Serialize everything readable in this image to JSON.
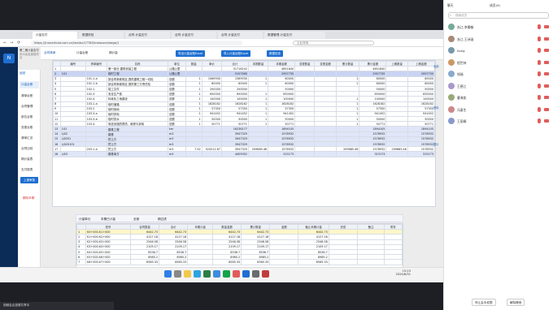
{
  "browser": {
    "tabs": [
      "计量支付",
      "数据校验",
      "合同-计量支付",
      "合同-计量支付",
      "合同-计量支付",
      "数据管理-计量支付"
    ],
    "url": "https://jl.smartcod.com.cn/tender/17785/measure/stage/1",
    "search_placeholder": "点此搜索"
  },
  "app": {
    "project": "第二期计量支付",
    "subtitle": "贵州省高速路项目",
    "back": "返回",
    "nav": [
      "计量台账",
      "清单台账",
      "合同管理",
      "部位台账",
      "变更台账",
      "清单汇总",
      "合同比较",
      "期计量表",
      "支付报表",
      "结算报表"
    ],
    "nav_button": "上报审核",
    "nav_action": "删除本期",
    "toolbar_left": [
      "合同清单",
      "计量台账",
      "期计量"
    ],
    "toolbar_buttons": [
      "导出计量台账Excel",
      "导入计量台账Excel",
      "数据检查"
    ]
  },
  "grid1": {
    "headers": [
      "",
      "编号",
      "清单编号",
      "名称",
      "单位",
      "数量",
      "单价",
      "合计",
      "本期数量",
      "本期金额",
      "变更数量",
      "变更金额",
      "累计数量",
      "累计金额",
      "上期数量",
      "上期金额"
    ],
    "rows": [
      {
        "cls": "",
        "no": "1",
        "code": "",
        "bill": "",
        "name": "第一部分 建筑安装工程",
        "unit": "公路公里",
        "qty": "",
        "price": "",
        "total": "31716142",
        "q1": "",
        "a1": "4851840",
        "q2": "",
        "a2": "",
        "q3": "",
        "a3": "4851840",
        "q4": "",
        "a4": ""
      },
      {
        "cls": "blue",
        "no": "2",
        "code": "101",
        "bill": "",
        "name": "临时工程",
        "unit": "公路公里",
        "qty": "",
        "price": "",
        "total": "5157565",
        "q1": "",
        "a1": "2957735",
        "q2": "",
        "a2": "",
        "q3": "",
        "a3": "2957735",
        "q4": "",
        "a4": "2957735"
      },
      {
        "cls": "",
        "no": "3",
        "code": "",
        "bill": "101-1-a",
        "name": "按合同条款规定,提供建筑工程一切险",
        "unit": "总额",
        "qty": "1",
        "price": "1569930",
        "total": "1569930",
        "q1": "1",
        "a1": "60000",
        "q2": "",
        "a2": "",
        "q3": "1",
        "a3": "60000",
        "q4": "",
        "a4": "60000"
      },
      {
        "cls": "",
        "no": "4",
        "code": "",
        "bill": "101-1-b",
        "name": "按合同条款规定,提供第三方责任险",
        "unit": "总额",
        "qty": "1",
        "price": "60000",
        "total": "60000",
        "q1": "1",
        "a1": "60000",
        "q2": "",
        "a2": "",
        "q3": "1",
        "a3": "60000",
        "q4": "",
        "a4": "60000"
      },
      {
        "cls": "",
        "no": "5",
        "code": "",
        "bill": "102-1",
        "name": "竣工文件",
        "unit": "总额",
        "qty": "1",
        "price": "200000",
        "total": "200000",
        "q1": "",
        "a1": "50000",
        "q2": "",
        "a2": "",
        "q3": "",
        "a3": "50000",
        "q4": "",
        "a4": "50000"
      },
      {
        "cls": "",
        "no": "6",
        "code": "",
        "bill": "102-3",
        "name": "安全生产费",
        "unit": "总额",
        "qty": "1",
        "price": "650000",
        "total": "650000",
        "q1": "1",
        "a1": "650000",
        "q2": "",
        "a2": "",
        "q3": "",
        "a3": "650000",
        "q4": "",
        "a4": "650000"
      },
      {
        "cls": "",
        "no": "7",
        "code": "",
        "bill": "102-4",
        "name": "标准化工地建设",
        "unit": "总额",
        "qty": "1",
        "price": "100000",
        "total": "100000",
        "q1": "1",
        "a1": "100000",
        "q2": "",
        "a2": "",
        "q3": "1",
        "a3": "100000",
        "q4": "",
        "a4": "100000"
      },
      {
        "cls": "",
        "no": "8",
        "code": "",
        "bill": "103-1-a",
        "name": "临时道路",
        "unit": "总额",
        "qty": "1",
        "price": "1628162",
        "total": "1628162",
        "q1": "1",
        "a1": "1628162",
        "q2": "",
        "a2": "",
        "q3": "1",
        "a3": "1628162",
        "q4": "",
        "a4": "1628162"
      },
      {
        "cls": "",
        "no": "9",
        "code": "",
        "bill": "103-2",
        "name": "临时用地",
        "unit": "总额",
        "qty": "1",
        "price": "57350",
        "total": "57350",
        "q1": "1",
        "a1": "57350",
        "q2": "",
        "a2": "",
        "q3": "1",
        "a3": "57350",
        "q4": "",
        "a4": "57350"
      },
      {
        "cls": "",
        "no": "10",
        "code": "",
        "bill": "103-3-a",
        "name": "临时供电",
        "unit": "总额",
        "qty": "1",
        "price": "941452",
        "total": "941452",
        "q1": "1",
        "a1": "941452",
        "q2": "",
        "a2": "",
        "q3": "1",
        "a3": "941452",
        "q4": "",
        "a4": "941452"
      },
      {
        "cls": "",
        "no": "11",
        "code": "",
        "bill": "103-3-b",
        "name": "临时供水",
        "unit": "总额",
        "qty": "1",
        "price": "50000",
        "total": "50000",
        "q1": "1",
        "a1": "50000",
        "q2": "",
        "a2": "",
        "q3": "1",
        "a3": "50000",
        "q4": "",
        "a4": "50000"
      },
      {
        "cls": "",
        "no": "12",
        "code": "",
        "bill": "103-4",
        "name": "电信设施的提供、维修与拆除",
        "unit": "总额",
        "qty": "1",
        "price": "50771",
        "total": "50771",
        "q1": "1",
        "a1": "50771",
        "q2": "",
        "a2": "",
        "q3": "1",
        "a3": "50771",
        "q4": "",
        "a4": "50771"
      },
      {
        "cls": "lt",
        "no": "13",
        "code": "102",
        "bill": "",
        "name": "路基工程",
        "unit": "km",
        "qty": "",
        "price": "",
        "total": "16236177",
        "q1": "",
        "a1": "1894105",
        "q2": "",
        "a2": "",
        "q3": "",
        "a3": "1894105",
        "q4": "",
        "a4": "1894105"
      },
      {
        "cls": "lt",
        "no": "14",
        "code": "LJ02",
        "bill": "",
        "name": "路基",
        "unit": "m3",
        "qty": "",
        "price": "",
        "total": "3947329",
        "q1": "",
        "a1": "1578932",
        "q2": "",
        "a2": "",
        "q3": "",
        "a3": "1578932",
        "q4": "",
        "a4": "1578932"
      },
      {
        "cls": "lt",
        "no": "15",
        "code": "LJ0201",
        "bill": "",
        "name": "挖土方",
        "unit": "m3",
        "qty": "",
        "price": "",
        "total": "3947329",
        "q1": "",
        "a1": "1578932",
        "q2": "",
        "a2": "",
        "q3": "",
        "a3": "1578932",
        "q4": "",
        "a4": "1578932"
      },
      {
        "cls": "lt",
        "no": "16",
        "code": "LJ020101",
        "bill": "",
        "name": "挖土方",
        "unit": "m3",
        "qty": "",
        "price": "",
        "total": "3947329",
        "q1": "",
        "a1": "1578932",
        "q2": "",
        "a2": "",
        "q3": "",
        "a3": "1578932",
        "q4": "",
        "a4": "1578932"
      },
      {
        "cls": "",
        "no": "17",
        "code": "",
        "bill": "203-1-a",
        "name": "挖土方",
        "unit": "m3",
        "qty": "7.52",
        "price": "524211.67",
        "total": "3947329",
        "q1": "209685.46",
        "a1": "1578932",
        "q2": "",
        "a2": "",
        "q3": "209685.46",
        "a3": "1578932",
        "q4": "209685.46",
        "a4": "1578932"
      },
      {
        "cls": "lt",
        "no": "18",
        "code": "LJ03",
        "bill": "",
        "name": "路基填方",
        "unit": "m3",
        "qty": "",
        "price": "",
        "total": "4405952",
        "q1": "",
        "a1": "315173",
        "q2": "",
        "a2": "",
        "q3": "",
        "a3": "315173",
        "q4": "",
        "a4": "315173"
      }
    ]
  },
  "grid2_bar": {
    "label": "计量单元",
    "opts": [
      "本期已计量",
      "全部",
      "期过滤"
    ]
  },
  "grid2": {
    "headers": [
      "",
      "桩号",
      "合同数量",
      "合价",
      "本期计量",
      "数量金额",
      "累计数量",
      "金额",
      "截止本期计量",
      "完成",
      "备注",
      "附件"
    ],
    "rows": [
      {
        "no": "1",
        "name": "K0+000-K1+000",
        "q": "6442.73",
        "p": "6442.73",
        "c1": "",
        "c2": "6442.73",
        "c3": "6442.73",
        "c4": "",
        "c5": "6442.73",
        "sel": true
      },
      {
        "no": "2",
        "name": "K1+000-K2+000",
        "q": "4127.18",
        "p": "4127.18",
        "c1": "",
        "c2": "4127.18",
        "c3": "4127.18",
        "c4": "",
        "c5": "4127.18",
        "sel": false
      },
      {
        "no": "3",
        "name": "K2+000-K3+000",
        "q": "2546.58",
        "p": "2546.58",
        "c1": "",
        "c2": "2546.58",
        "c3": "2546.58",
        "c4": "",
        "c5": "2546.58",
        "sel": false
      },
      {
        "no": "4",
        "name": "K3+000-K4+000",
        "q": "2109.17",
        "p": "2109.17",
        "c1": "",
        "c2": "2109.17",
        "c3": "2109.17",
        "c4": "",
        "c5": "2109.17",
        "sel": false
      },
      {
        "no": "5",
        "name": "K4+000-K5+000",
        "q": "8536.7",
        "p": "8536.7",
        "c1": "",
        "c2": "8536.7",
        "c3": "8536.7",
        "c4": "",
        "c5": "8536.7",
        "sel": false
      },
      {
        "no": "6",
        "name": "K5+000-K6+000",
        "q": "8985.2",
        "p": "8985.2",
        "c1": "",
        "c2": "8985.2",
        "c3": "8985.2",
        "c4": "",
        "c5": "8985.2",
        "sel": false
      },
      {
        "no": "7",
        "name": "K6+000-K7+000",
        "q": "8565.33",
        "p": "8565.33",
        "c1": "",
        "c2": "8565.33",
        "c3": "8565.33",
        "c4": "",
        "c5": "8565.33",
        "sel": false
      }
    ]
  },
  "taskbar": {
    "time": "15:23",
    "date": "2024/8/31"
  },
  "chat": {
    "title": "聊天",
    "tab2": "成员(9)",
    "search_placeholder": "搜索成员",
    "members": [
      "浙江-李雅敏",
      "浙江-王诗涵",
      "hong",
      "程世林",
      "钱瑞",
      "王德江",
      "曹海凯",
      "冯泰生",
      "王丽娟"
    ],
    "side_labels": [
      "全部",
      "资料",
      "图片"
    ],
    "buttons": [
      "停止会中权限",
      "解除静音"
    ]
  },
  "screenshare": {
    "bar": "视频会议投屏共享中"
  }
}
